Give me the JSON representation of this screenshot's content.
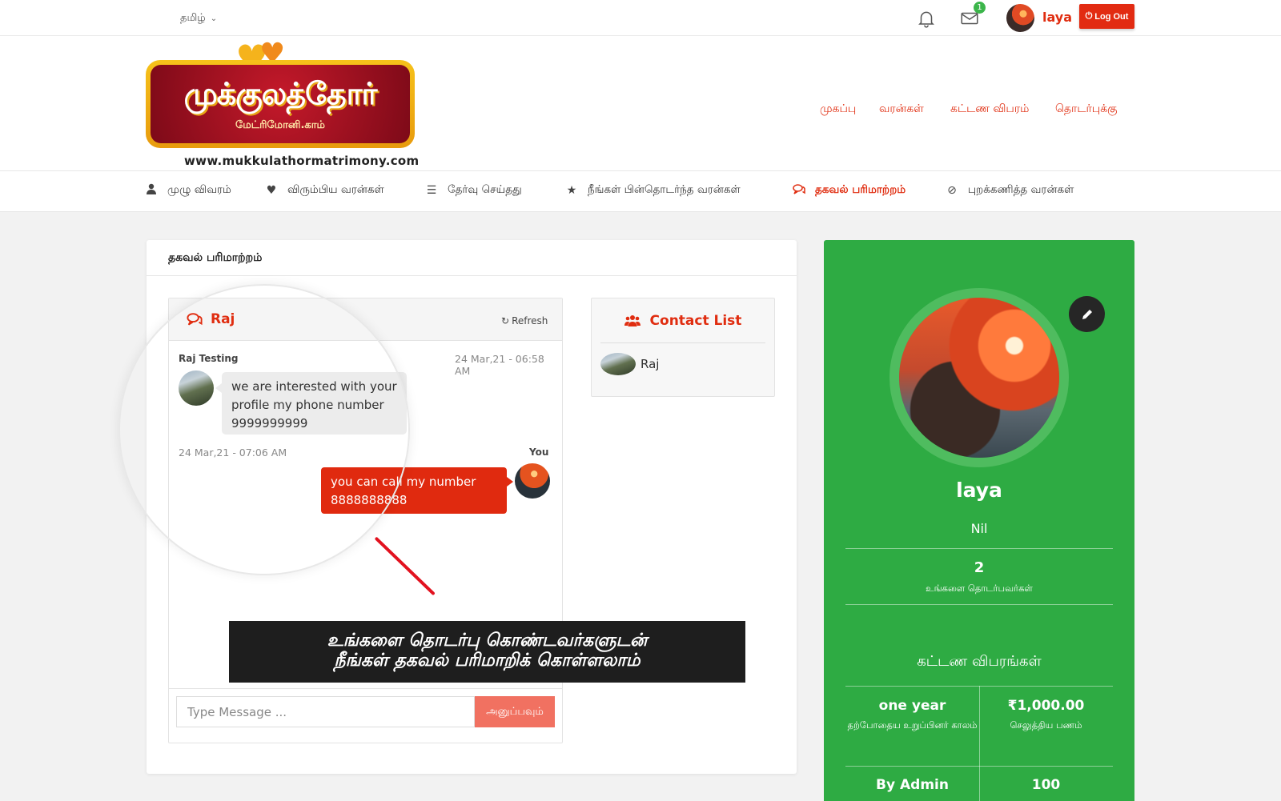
{
  "topbar": {
    "language": "தமிழ்",
    "mail_badge": "1",
    "username": "laya",
    "logout_label": "Log Out"
  },
  "logo": {
    "title": "முக்குலத்தோர்",
    "subtitle": "மேட்ரிமோனி.காம்",
    "url": "www.mukkulathormatrimony.com"
  },
  "main_nav": [
    "முகப்பு",
    "வரன்கள்",
    "கட்டண விபரம்",
    "தொடர்புக்கு"
  ],
  "sub_nav": [
    {
      "label": "முழு விவரம்",
      "icon": "user-icon"
    },
    {
      "label": "விரும்பிய வரன்கள்",
      "icon": "heart-icon"
    },
    {
      "label": "தேர்வு செய்தது",
      "icon": "list-icon"
    },
    {
      "label": "நீங்கள் பின்தொடர்ந்த வரன்கள்",
      "icon": "star-icon"
    },
    {
      "label": "தகவல் பரிமாற்றம்",
      "icon": "chat-icon",
      "active": true
    },
    {
      "label": "புறக்கணித்த வரன்கள்",
      "icon": "ban-icon"
    }
  ],
  "card": {
    "title": "தகவல் பரிமாற்றம்",
    "chat": {
      "contact_name": "Raj",
      "refresh_label": "Refresh",
      "incoming": {
        "sender": "Raj Testing",
        "time": "24 Mar,21 - 06:58 AM",
        "text": "we are interested with your profile my phone number 9999999999"
      },
      "outgoing": {
        "sender": "You",
        "time": "24 Mar,21 - 07:06 AM",
        "text": "you can call my number 8888888888"
      },
      "input_placeholder": "Type Message ...",
      "send_label": "அனுப்பவும்"
    },
    "contacts": {
      "title": "Contact List",
      "items": [
        "Raj"
      ]
    }
  },
  "callout": {
    "line1": "உங்களை தொடர்பு கொண்டவர்களுடன்",
    "line2": "நீங்கள்  தகவல் பரிமாறிக் கொள்ளலாம்"
  },
  "profile": {
    "name": "laya",
    "status": "Nil",
    "contacts_count": "2",
    "contacts_label": "உங்களை தொடர்பவர்கள்",
    "plan_title": "கட்டண விபரங்கள்",
    "plan_duration": "one year",
    "plan_duration_label": "தற்போதைய உறுப்பினர் காலம்",
    "plan_amount": "₹1,000.00",
    "plan_amount_label": "செலுத்திய பணம்",
    "plan_by": "By Admin",
    "plan_count": "100"
  },
  "colors": {
    "accent": "#e02d10",
    "profile_bg": "#2eab43",
    "send_button": "#f17161",
    "badge": "#3bb54a"
  }
}
